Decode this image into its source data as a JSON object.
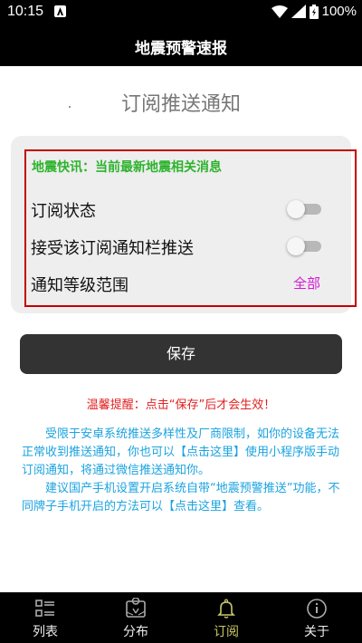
{
  "status": {
    "time": "10:15",
    "battery": "100%"
  },
  "app": {
    "title": "地震预警速报"
  },
  "page": {
    "heading": "订阅推送通知"
  },
  "card": {
    "quick_news": "地震快讯：当前最新地震相关消息",
    "rows": [
      {
        "label": "订阅状态",
        "state": false
      },
      {
        "label": "接受该订阅通知栏推送",
        "state": false
      },
      {
        "label": "通知等级范围",
        "value": "全部"
      }
    ]
  },
  "save_label": "保存",
  "tip": "温馨提醒：点击“保存”后才会生效！",
  "info": [
    "　　受限于安卓系统推送多样性及厂商限制，如你的设备无法正常收到推送通知，你也可以【点击这里】使用小程序版手动订阅通知，将通过微信推送通知你。",
    "　　建议国产手机设置开启系统自带“地震预警推送”功能，不同牌子手机开启的方法可以【点击这里】查看。"
  ],
  "nav": {
    "active": "订阅",
    "items": [
      {
        "label": "列表",
        "icon": "list-icon"
      },
      {
        "label": "分布",
        "icon": "map-icon"
      },
      {
        "label": "订阅",
        "icon": "bell-icon"
      },
      {
        "label": "关于",
        "icon": "info-icon"
      }
    ]
  },
  "colors": {
    "header_bg": "#000000",
    "accent_green": "#2db32d",
    "highlight_red": "#c40000",
    "level_magenta": "#d41ad4",
    "tip_red": "#e02020",
    "info_blue": "#1aa3e0",
    "active_nav": "#c9c96b"
  }
}
